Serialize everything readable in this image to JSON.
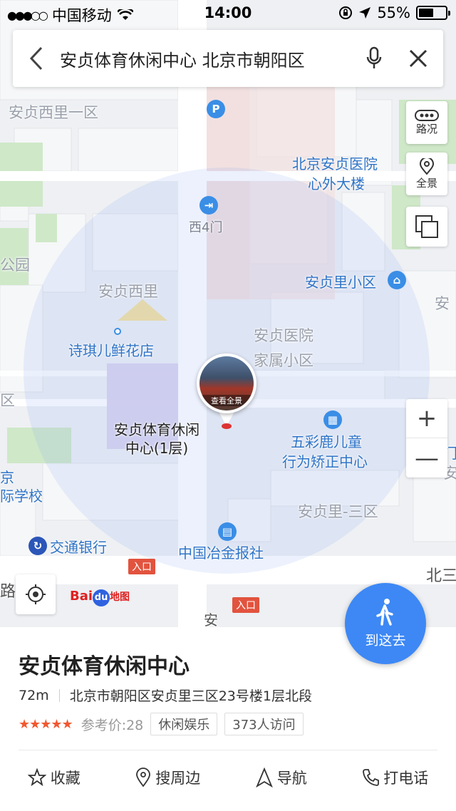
{
  "status_bar": {
    "carrier": "中国移动",
    "time": "14:00",
    "battery_percent": "55%",
    "battery_level": 0.55
  },
  "search": {
    "query": "安贞体育休闲中心 北京市朝阳区"
  },
  "controls": {
    "traffic_label": "路况",
    "panorama_label": "全景",
    "zoom_in": "+",
    "zoom_out": "—"
  },
  "map": {
    "labels": {
      "anzhen_xili_1": "安贞西里一区",
      "hospital": "北京安贞医院",
      "hospital_2": "心外大楼",
      "west_gate": "西4门",
      "park": "公园",
      "anzhen_xili": "安贞西里",
      "anzhenli_xiaoqu": "安贞里小区",
      "anzhen_right": "安",
      "flower_shop": "诗琪儿鲜花店",
      "hospital_housing_1": "安贞医院",
      "hospital_housing_2": "家属小区",
      "wucailu_1": "五彩鹿儿童",
      "wucailu_2": "行为矫正中心",
      "school_1": "京",
      "school_2": "际学校",
      "anzhenli_3": "安贞里-三区",
      "bank": "交通银行",
      "newspaper": "中国冶金报社",
      "beisan": "北三",
      "lu": "路",
      "an_bottom": "安",
      "right_edge_1": "门",
      "right_edge_2": "安",
      "left_edge": "区"
    },
    "entrance_label": "入口",
    "marker_caption": "查看全景",
    "place_name_line1": "安贞体育休闲",
    "place_name_line2": "中心(1层)",
    "logo_bai": "Bai",
    "logo_du": "du",
    "logo_map": "地图"
  },
  "go_button": {
    "label": "到这去"
  },
  "place": {
    "name": "安贞体育休闲中心",
    "distance": "72m",
    "address": "北京市朝阳区安贞里三区23号楼1层北段",
    "stars": "★★★★★",
    "rating": 4.5,
    "price_label": "参考价:28",
    "tags": [
      "休闲娱乐",
      "373人访问"
    ]
  },
  "actions": {
    "favorite": "收藏",
    "nearby": "搜周边",
    "navigate": "导航",
    "call": "打电话"
  }
}
